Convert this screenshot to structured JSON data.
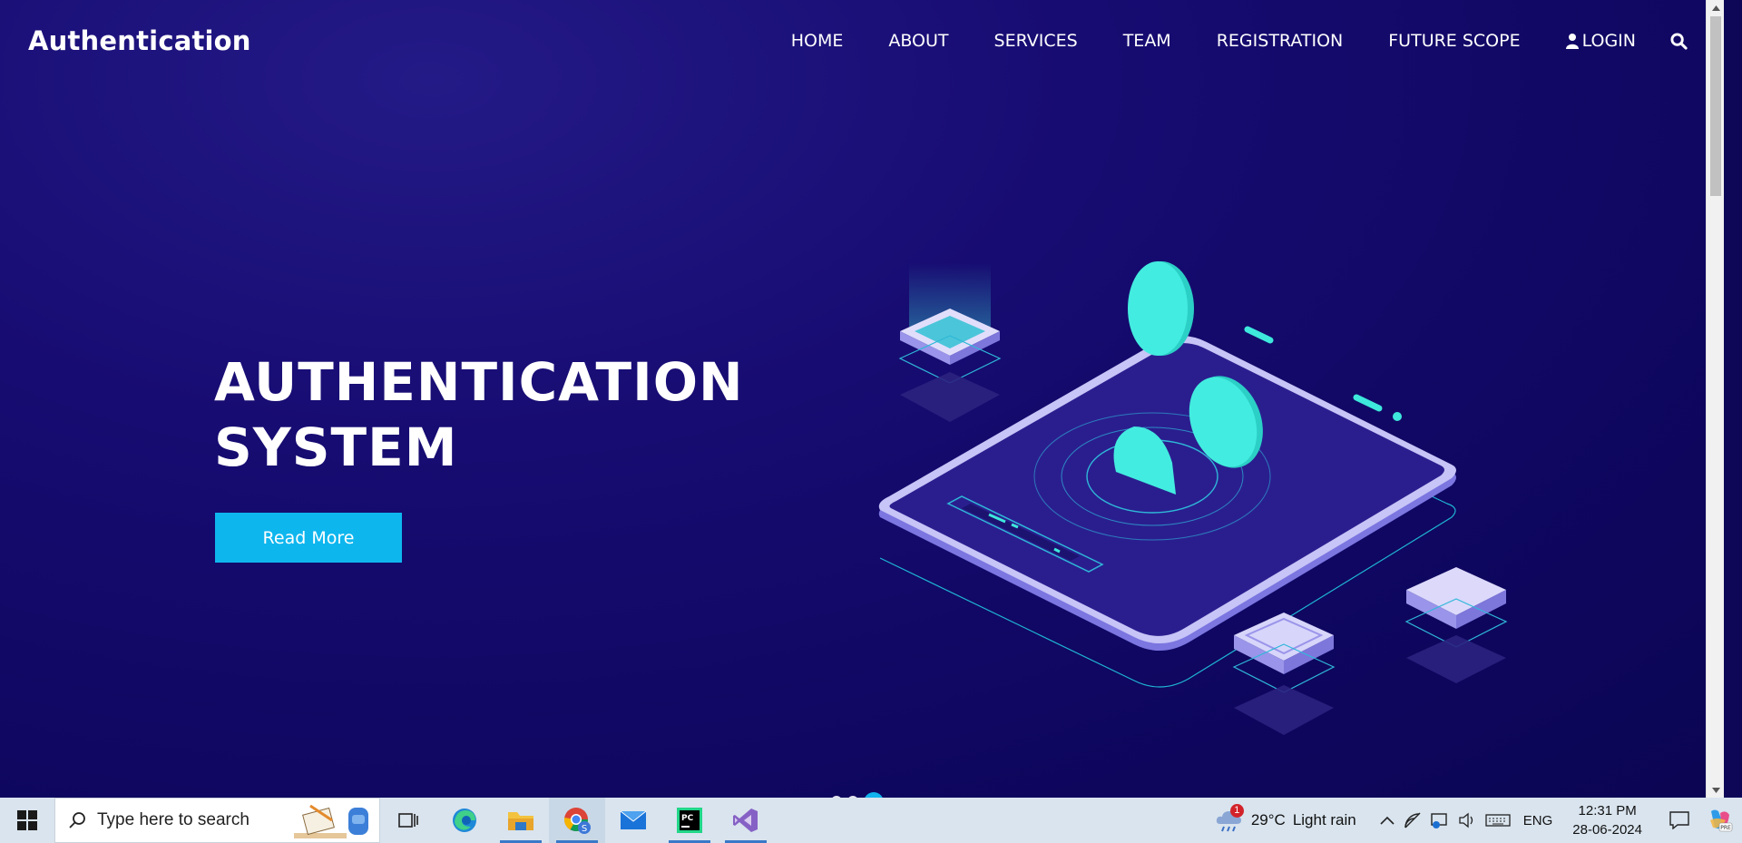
{
  "brand": "Authentication",
  "nav": {
    "items": [
      "HOME",
      "ABOUT",
      "SERVICES",
      "TEAM",
      "REGISTRATION",
      "FUTURE SCOPE"
    ],
    "login": "LOGIN"
  },
  "hero": {
    "title_line1": "AUTHENTICATION",
    "title_line2": "SYSTEM",
    "button": "Read More"
  },
  "carousel": {
    "slides": 3,
    "active": 3
  },
  "taskbar": {
    "search_placeholder": "Type here to search",
    "weather_temp": "29°C",
    "weather_desc": "Light rain",
    "weather_badge": "1",
    "language": "ENG",
    "time": "12:31 PM",
    "date": "28-06-2024"
  },
  "colors": {
    "accent": "#0eb6ee",
    "background": "#140a6b",
    "teal": "#3ee8dc",
    "lavender": "#b9b6f4"
  }
}
